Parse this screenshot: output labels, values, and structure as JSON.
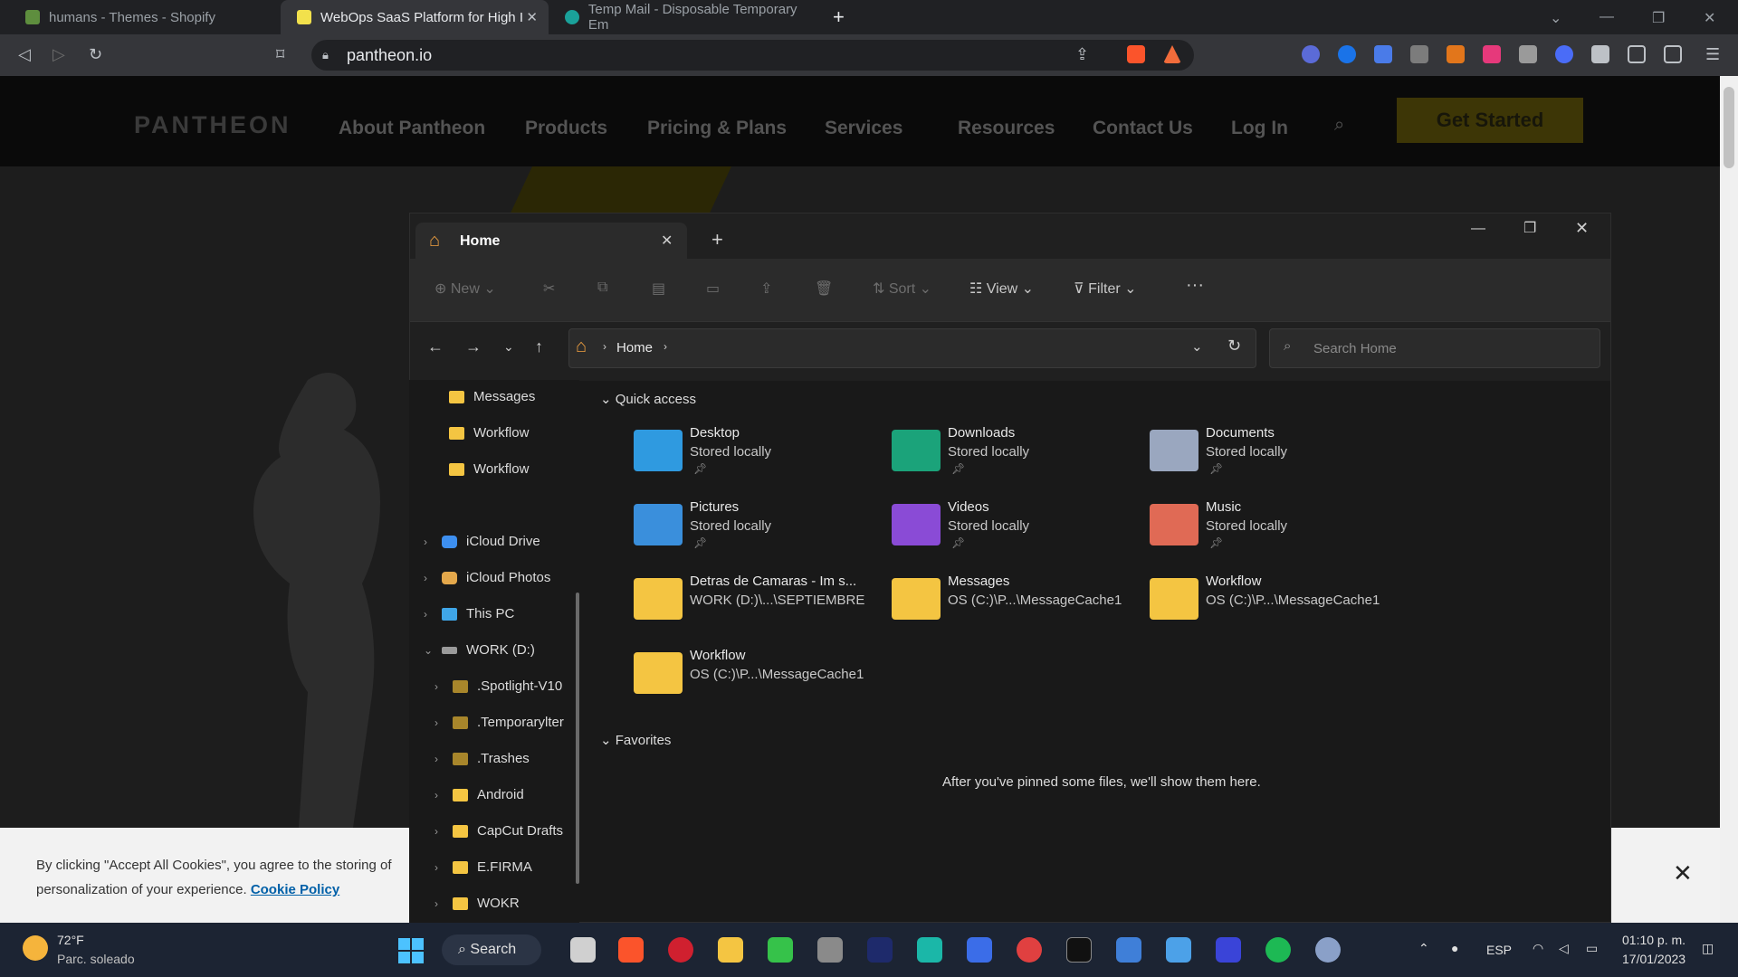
{
  "browser": {
    "tabs": [
      {
        "title": "humans - Themes - Shopify"
      },
      {
        "title": "WebOps SaaS Platform for High I"
      },
      {
        "title": "Temp Mail - Disposable Temporary Em"
      }
    ],
    "url": "pantheon.io"
  },
  "site": {
    "logo": "PANTHEON",
    "nav": [
      "About Pantheon",
      "Products",
      "Pricing & Plans",
      "Services",
      "Resources",
      "Contact Us",
      "Log In"
    ],
    "cta": "Get Started",
    "cookie_text": "By clicking \"Accept All Cookies\", you agree to the storing of",
    "cookie_text2": "personalization of your experience.",
    "cookie_link": "Cookie Policy",
    "cookie_close": "✕"
  },
  "explorer": {
    "tab_title": "Home",
    "toolbar": {
      "new": "New",
      "sort": "Sort",
      "view": "View",
      "filter": "Filter",
      "more": "···"
    },
    "breadcrumb": "Home",
    "search_placeholder": "Search Home",
    "sidebar": [
      {
        "label": "Messages"
      },
      {
        "label": "Workflow"
      },
      {
        "label": "Workflow"
      },
      {
        "label": "iCloud Drive"
      },
      {
        "label": "iCloud Photos"
      },
      {
        "label": "This PC"
      },
      {
        "label": "WORK (D:)"
      },
      {
        "label": ".Spotlight-V10"
      },
      {
        "label": ".Temporarylter"
      },
      {
        "label": ".Trashes"
      },
      {
        "label": "Android"
      },
      {
        "label": "CapCut Drafts"
      },
      {
        "label": "E.FIRMA"
      },
      {
        "label": "WOKR"
      }
    ],
    "quick_access_label": "Quick access",
    "quick_access": [
      {
        "name": "Desktop",
        "sub": "Stored locally",
        "color": "#2f9ae0"
      },
      {
        "name": "Downloads",
        "sub": "Stored locally",
        "color": "#1ba37a"
      },
      {
        "name": "Documents",
        "sub": "Stored locally",
        "color": "#9aa7bf"
      },
      {
        "name": "Pictures",
        "sub": "Stored locally",
        "color": "#3a8fdc"
      },
      {
        "name": "Videos",
        "sub": "Stored locally",
        "color": "#8a4bd6"
      },
      {
        "name": "Music",
        "sub": "Stored locally",
        "color": "#e06a55"
      },
      {
        "name": "Detras de Camaras - Im s...",
        "sub": "WORK (D:)\\...\\SEPTIEMBRE",
        "color": "#f4c542"
      },
      {
        "name": "Messages",
        "sub": "OS (C:)\\P...\\MessageCache1",
        "color": "#f4c542"
      },
      {
        "name": "Workflow",
        "sub": "OS (C:)\\P...\\MessageCache1",
        "color": "#f4c542"
      },
      {
        "name": "Workflow",
        "sub": "OS (C:)\\P...\\MessageCache1",
        "color": "#f4c542"
      }
    ],
    "favorites_label": "Favorites",
    "favorites_empty": "After you've pinned some files, we'll show them here."
  },
  "taskbar": {
    "weather_temp": "72°F",
    "weather_desc": "Parc. soleado",
    "search": "Search",
    "lang": "ESP",
    "time": "01:10 p. m.",
    "date": "17/01/2023"
  }
}
